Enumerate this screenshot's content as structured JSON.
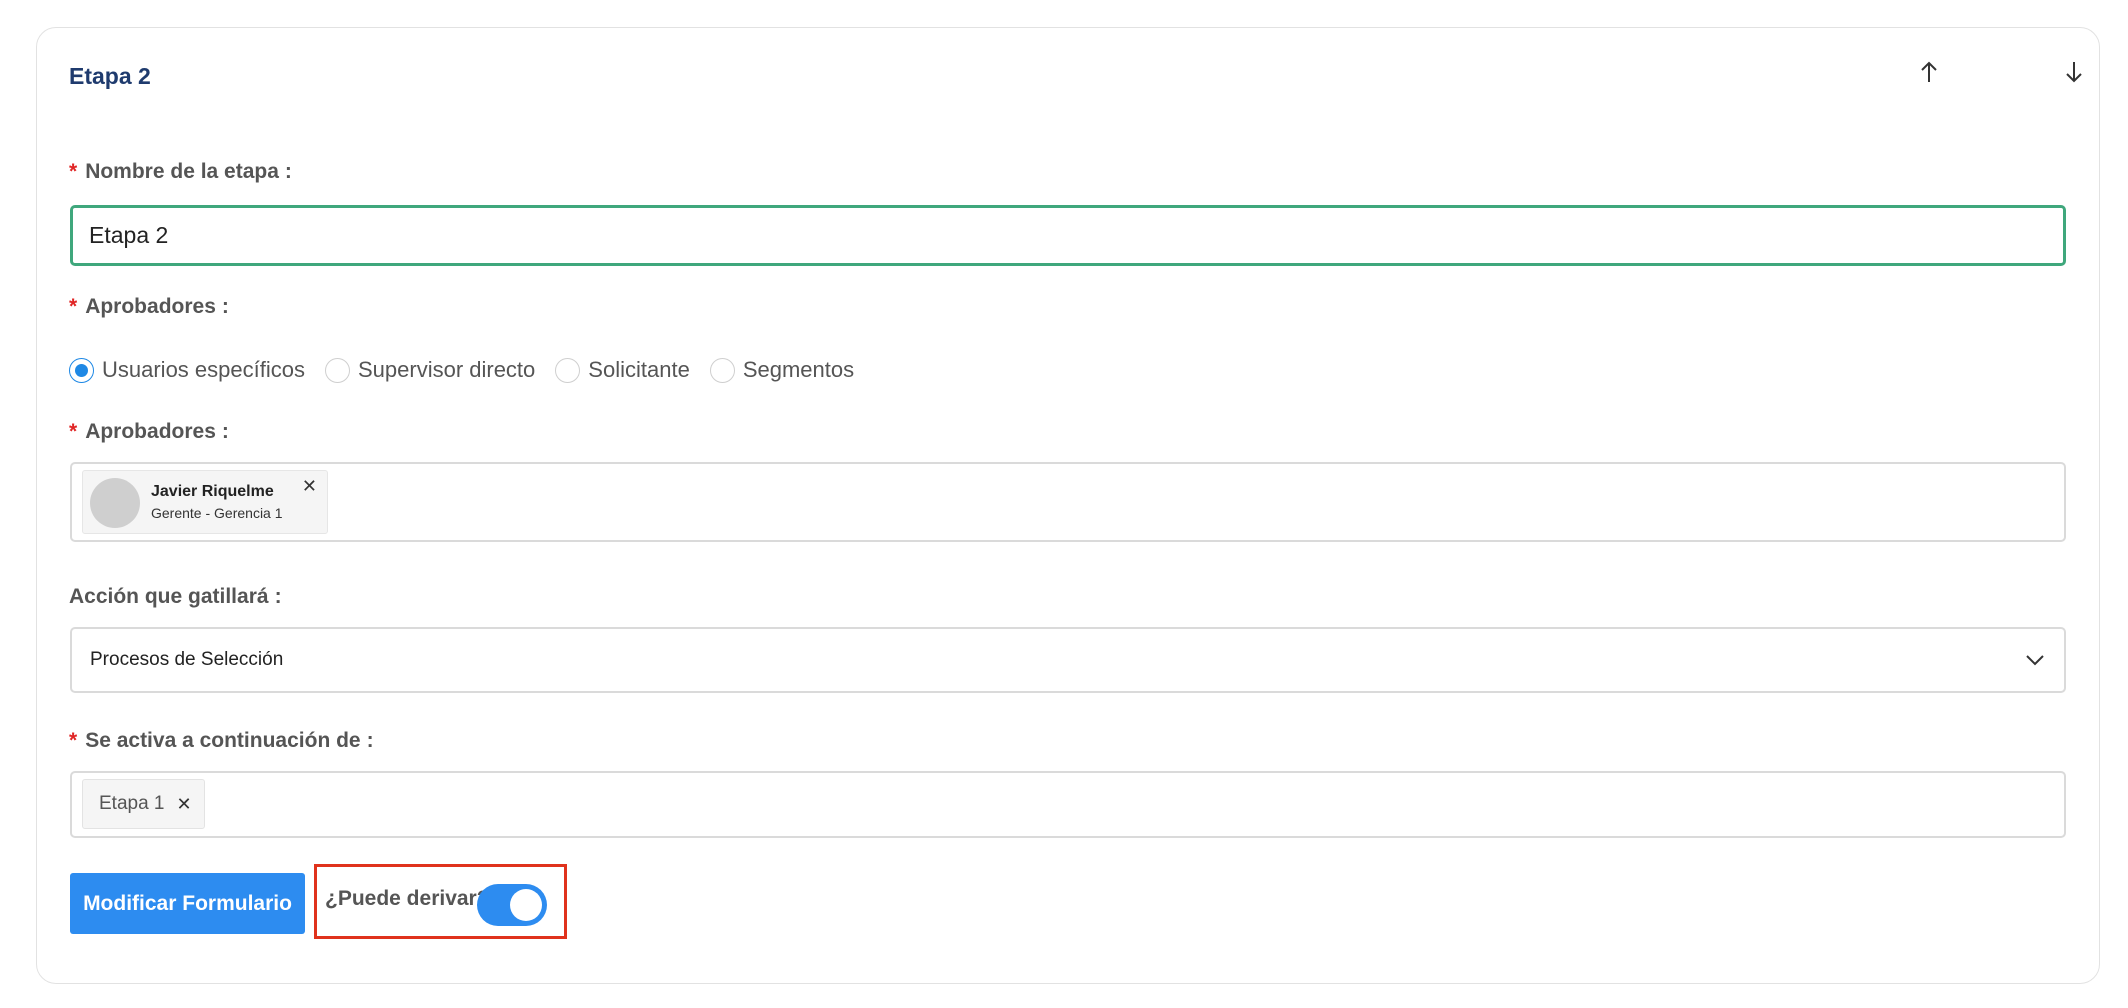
{
  "stage": {
    "title": "Etapa 2",
    "move_up_icon": "arrow-up-icon",
    "move_down_icon": "arrow-down-icon"
  },
  "name_field": {
    "required_mark": "*",
    "label": "Nombre de la etapa",
    "colon": ":",
    "value": "Etapa 2"
  },
  "approvers_type": {
    "required_mark": "*",
    "label": "Aprobadores",
    "colon": ":",
    "options": [
      {
        "label": "Usuarios específicos",
        "selected": true
      },
      {
        "label": "Supervisor directo",
        "selected": false
      },
      {
        "label": "Solicitante",
        "selected": false
      },
      {
        "label": "Segmentos",
        "selected": false
      }
    ]
  },
  "approvers": {
    "required_mark": "*",
    "label": "Aprobadores",
    "colon": ":",
    "selected_users": [
      {
        "name": "Javier Riquelme",
        "role": "Gerente - Gerencia 1",
        "remove_icon": "close-icon"
      }
    ]
  },
  "action": {
    "label": "Acción que gatillará",
    "colon": ":",
    "value": "Procesos de Selección",
    "chevron_icon": "chevron-down-icon"
  },
  "activates_after": {
    "required_mark": "*",
    "label": "Se activa a continuación de",
    "colon": ":",
    "tags": [
      {
        "label": "Etapa 1",
        "remove_icon": "close-icon"
      }
    ]
  },
  "footer": {
    "modify_form_button": "Modificar Formulario",
    "can_derive_label": "¿Puede derivar?",
    "can_derive_enabled": true
  },
  "colors": {
    "primary": "#2d8cf0",
    "title": "#1f3b6e",
    "input_focus_border": "#3fa77c",
    "required": "#e02424",
    "highlight_border": "#e0321c"
  }
}
